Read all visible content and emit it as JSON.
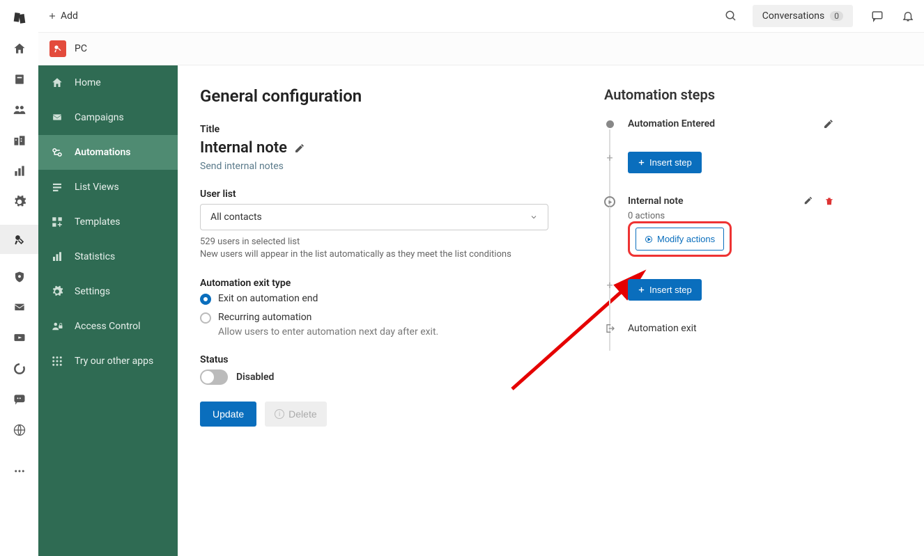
{
  "topbar": {
    "add": "Add",
    "conversations": "Conversations",
    "conv_count": "0"
  },
  "workspace": {
    "name": "PC"
  },
  "sidebar": {
    "items": [
      {
        "label": "Home"
      },
      {
        "label": "Campaigns"
      },
      {
        "label": "Automations"
      },
      {
        "label": "List Views"
      },
      {
        "label": "Templates"
      },
      {
        "label": "Statistics"
      },
      {
        "label": "Settings"
      },
      {
        "label": "Access Control"
      },
      {
        "label": "Try our other apps"
      }
    ]
  },
  "page": {
    "title": "General configuration",
    "title_label": "Title",
    "automation_title": "Internal note",
    "automation_sub": "Send internal notes",
    "userlist_label": "User list",
    "userlist_value": "All contacts",
    "userlist_helper1": "529 users in selected list",
    "userlist_helper2": "New users will appear in the list automatically as they meet the list conditions",
    "exit_label": "Automation exit type",
    "exit_opt1": "Exit on automation end",
    "exit_opt2": "Recurring automation",
    "exit_opt2_sub": "Allow users to enter automation next day after exit.",
    "status_label": "Status",
    "status_value": "Disabled",
    "btn_update": "Update",
    "btn_delete": "Delete"
  },
  "steps": {
    "title": "Automation steps",
    "entered": "Automation Entered",
    "insert": "Insert step",
    "internal_note": "Internal note",
    "actions_count": "0 actions",
    "modify": "Modify actions",
    "exit": "Automation exit"
  }
}
